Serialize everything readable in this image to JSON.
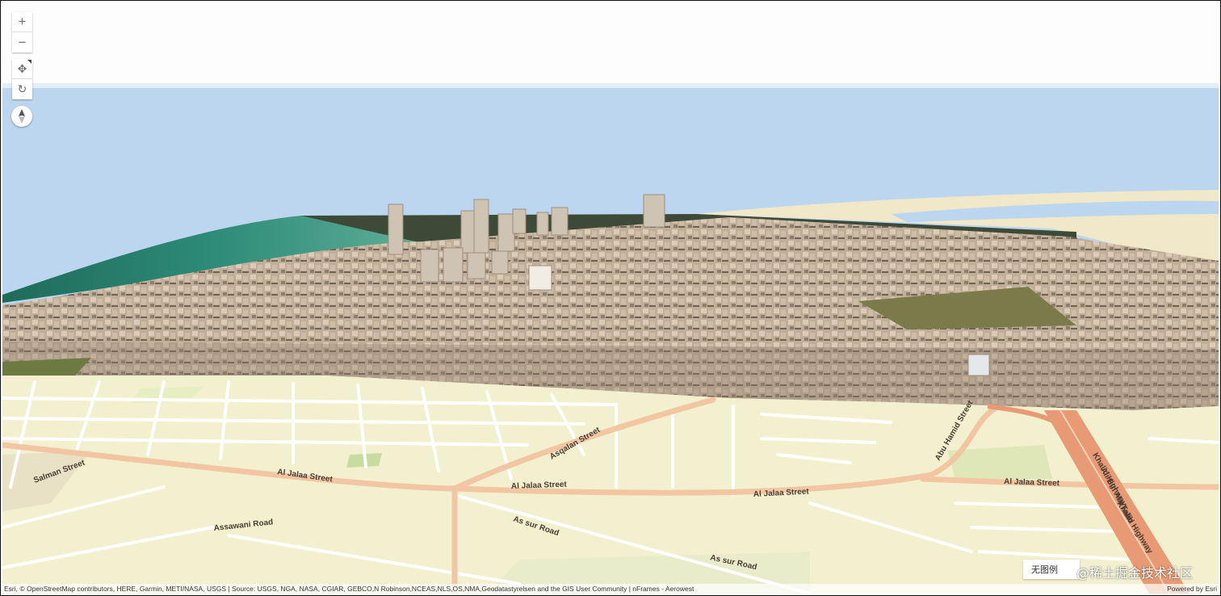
{
  "controls": {
    "zoom_in": "+",
    "zoom_out": "−",
    "pan": "✥",
    "rotate": "↻",
    "compass": "N"
  },
  "legend": {
    "label": "无图例"
  },
  "watermark": "@稀土掘金技术社区",
  "attribution": {
    "left": "Esri, © OpenStreetMap contributors, HERE, Garmin, METI/NASA, USGS | Source: USGS, NGA, NASA, CGIAR, GEBCO,N Robinson,NCEAS,NLS,OS,NMA,Geodatastyrelsen and the GIS User Community | nFrames - Aerowest",
    "right": "Powered by Esri"
  },
  "roads": {
    "r1": "Al Jalaa Street",
    "r2": "Al Jalaa Street",
    "r3": "Al Jalaa Street",
    "r4": "Al Jalaa Street",
    "r5": "Asqalan Street",
    "r6": "Assawani Road",
    "r7": "As sur Road",
    "r8": "As sur Road",
    "r9": "Salman Street",
    "r10": "Abu Hamid Street",
    "r11": "Khalid Highway",
    "r12": "Ali Bin Abi Talib",
    "r13": "Khalid Highway"
  },
  "colors": {
    "sky": "#fdfdfd",
    "water": "#bdd6ef",
    "sea_green": "#2b7a66",
    "basemap_land": "#f3f0cf",
    "road": "#ffffff",
    "major_road": "#f2c6a2",
    "highway": "#e79a73",
    "buildings": "#c9b8a2"
  }
}
